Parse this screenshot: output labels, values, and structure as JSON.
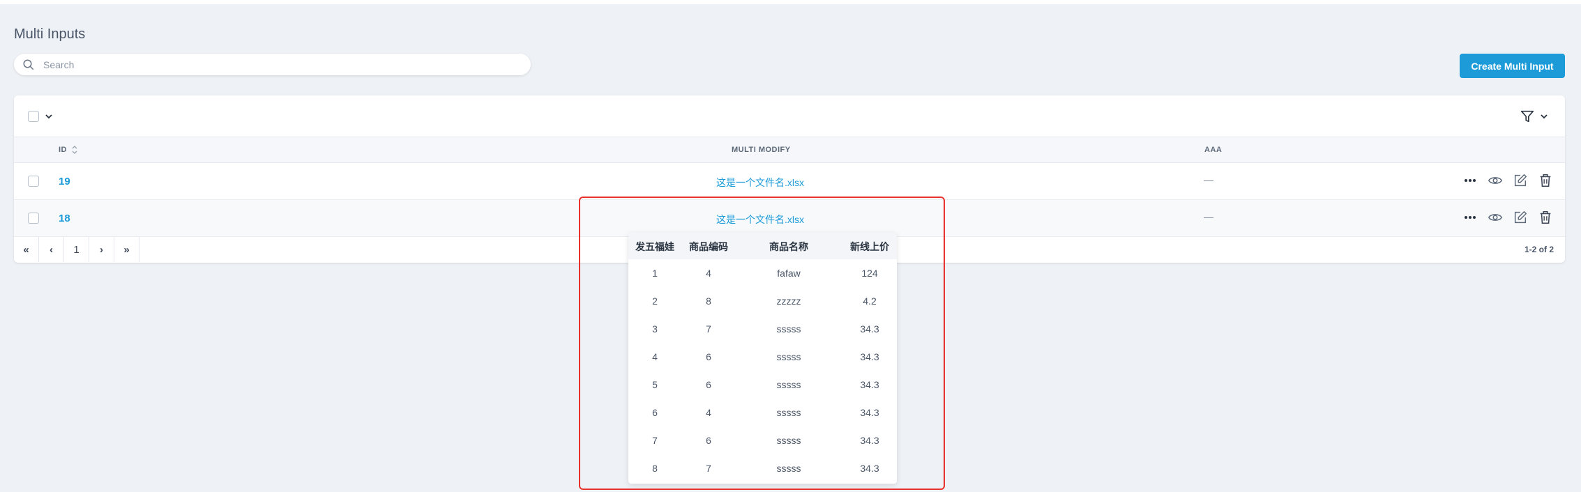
{
  "page": {
    "title": "Multi Inputs"
  },
  "search": {
    "placeholder": "Search"
  },
  "toolbar": {
    "create_label": "Create Multi Input"
  },
  "table": {
    "columns": [
      "ID",
      "MULTI MODIFY",
      "AAA"
    ],
    "rows": [
      {
        "id": "19",
        "file": "这是一个文件名.xlsx",
        "aaa": "—"
      },
      {
        "id": "18",
        "file": "这是一个文件名.xlsx",
        "aaa": "—"
      }
    ],
    "pagination": {
      "first": "«",
      "prev": "‹",
      "page": "1",
      "next": "›",
      "last": "»",
      "count": "1-2 of 2"
    }
  },
  "popover": {
    "headers": [
      "发五福娃",
      "商品编码",
      "商品名称",
      "新线上价"
    ],
    "rows": [
      [
        "1",
        "4",
        "fafaw",
        "124"
      ],
      [
        "2",
        "8",
        "zzzzz",
        "4.2"
      ],
      [
        "3",
        "7",
        "sssss",
        "34.3"
      ],
      [
        "4",
        "6",
        "sssss",
        "34.3"
      ],
      [
        "5",
        "6",
        "sssss",
        "34.3"
      ],
      [
        "6",
        "4",
        "sssss",
        "34.3"
      ],
      [
        "7",
        "6",
        "sssss",
        "34.3"
      ],
      [
        "8",
        "7",
        "sssss",
        "34.3"
      ]
    ]
  },
  "icons": [
    "search-icon",
    "chevron-down-icon",
    "filter-icon",
    "sort-icon",
    "more-icon",
    "eye-icon",
    "edit-icon",
    "trash-icon"
  ],
  "colors": {
    "accent": "#1c9bd8",
    "highlight": "#e8322b",
    "background": "#eef1f5"
  }
}
